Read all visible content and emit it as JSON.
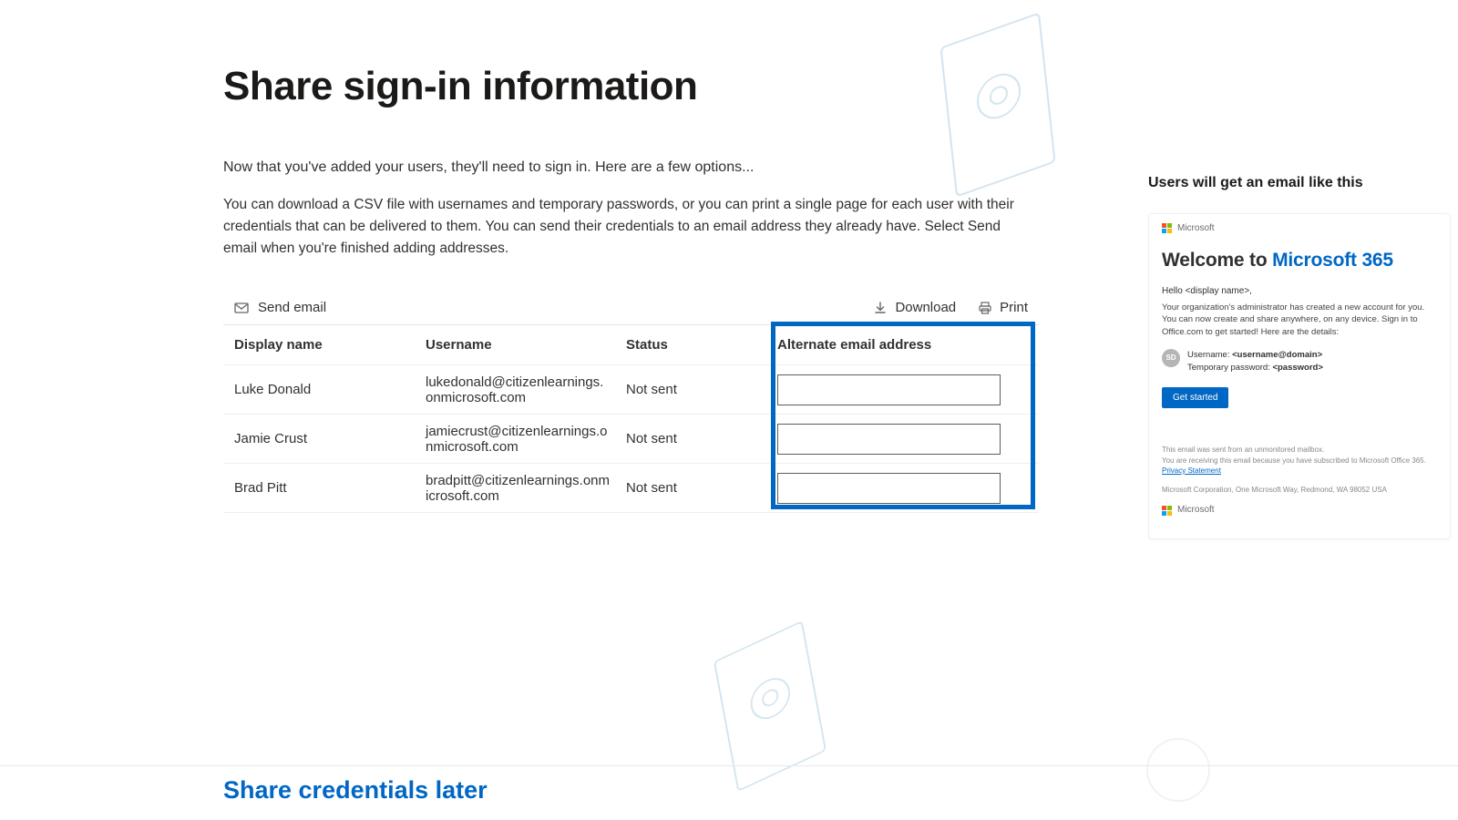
{
  "page": {
    "title": "Share sign-in information",
    "intro1": "Now that you've added your users, they'll need to sign in. Here are a few options...",
    "intro2": "You can download a CSV file with usernames and temporary passwords, or you can print a single page for each user with their credentials that can be delivered to them. You can send their credentials to an email address they already have. Select Send email when you're finished adding addresses."
  },
  "actions": {
    "send_email": "Send email",
    "download": "Download",
    "print": "Print"
  },
  "table": {
    "headers": {
      "display_name": "Display name",
      "username": "Username",
      "status": "Status",
      "alt_email": "Alternate email address"
    },
    "rows": [
      {
        "display_name": "Luke Donald",
        "username": "lukedonald@citizenlearnings.onmicrosoft.com",
        "status": "Not sent",
        "alt_email": ""
      },
      {
        "display_name": "Jamie Crust",
        "username": "jamiecrust@citizenlearnings.onmicrosoft.com",
        "status": "Not sent",
        "alt_email": ""
      },
      {
        "display_name": "Brad Pitt",
        "username": "bradpitt@citizenlearnings.onmicrosoft.com",
        "status": "Not sent",
        "alt_email": ""
      }
    ]
  },
  "share_later": "Share credentials later",
  "preview": {
    "heading": "Users will get an email like this",
    "brand": "Microsoft",
    "welcome_prefix": "Welcome to ",
    "welcome_product": "Microsoft 365",
    "hello": "Hello <display name>,",
    "body": "Your organization's administrator has created a new account for you. You can now create and share anywhere, on any device. Sign in to Office.com to get started! Here are the details:",
    "avatar_initials": "SD",
    "cred_username_label": "Username: ",
    "cred_username_value": "<username@domain>",
    "cred_password_label": "Temporary password: ",
    "cred_password_value": "<password>",
    "get_started": "Get started",
    "footer_line1": "This email was sent from an unmonitored mailbox.",
    "footer_line2": "You are receiving this email because you have subscribed to Microsoft Office 365.",
    "privacy": "Privacy Statement",
    "footer_addr": "Microsoft Corporation, One Microsoft Way, Redmond, WA 98052 USA"
  }
}
